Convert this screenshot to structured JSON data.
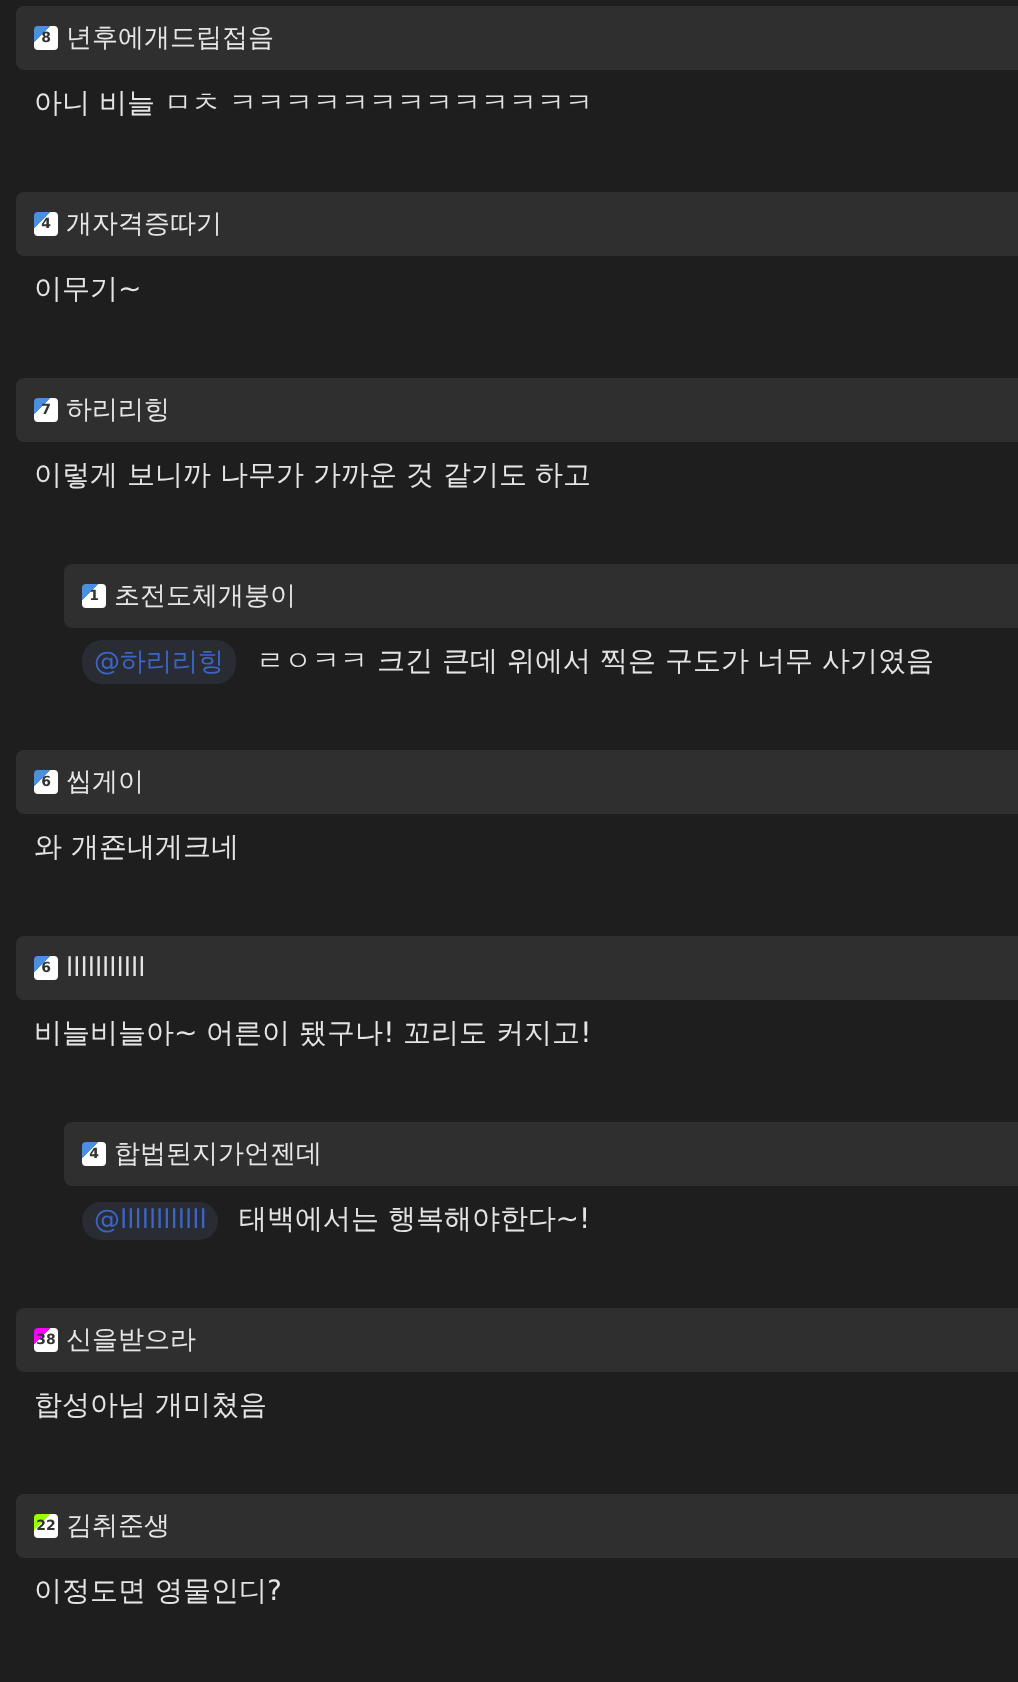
{
  "comments": [
    {
      "level": "8",
      "color": "#4a8fe0",
      "author": "년후에개드립접음",
      "text": "아니 비늘 ㅁㅊ ㅋㅋㅋㅋㅋㅋㅋㅋㅋㅋㅋㅋㅋ"
    },
    {
      "level": "4",
      "color": "#4a8fe0",
      "author": "개자격증따기",
      "text": "이무기~"
    },
    {
      "level": "7",
      "color": "#4a8fe0",
      "author": "하리리힝",
      "text": "이렇게 보니까 나무가 가까운 것 같기도 하고",
      "children": [
        {
          "level": "1",
          "color": "#4a8fe0",
          "author": "초전도체개붕이",
          "mention": "@하리리힝",
          "text": "ㄹㅇㅋㅋ 크긴 큰데 위에서 찍은 구도가 너무 사기였음"
        }
      ]
    },
    {
      "level": "6",
      "color": "#4a8fe0",
      "author": "씹게이",
      "text": "와 개죤내게크네"
    },
    {
      "level": "6",
      "color": "#4a8fe0",
      "author": "lllllllllll",
      "text": "비늘비늘아~ 어른이 됐구나! 꼬리도 커지고!",
      "children": [
        {
          "level": "4",
          "color": "#4a8fe0",
          "author": "합법된지가언젠데",
          "mention": "@llllllllllll",
          "text": "태백에서는 행복해야한다~!"
        }
      ]
    },
    {
      "level": "38",
      "color": "#ff00ff",
      "author": "신을받으라",
      "text": "합성아님 개미쳤음"
    },
    {
      "level": "22",
      "color": "#9aff00",
      "author": "김취준생",
      "text": "이정도면 영물인디?"
    }
  ]
}
